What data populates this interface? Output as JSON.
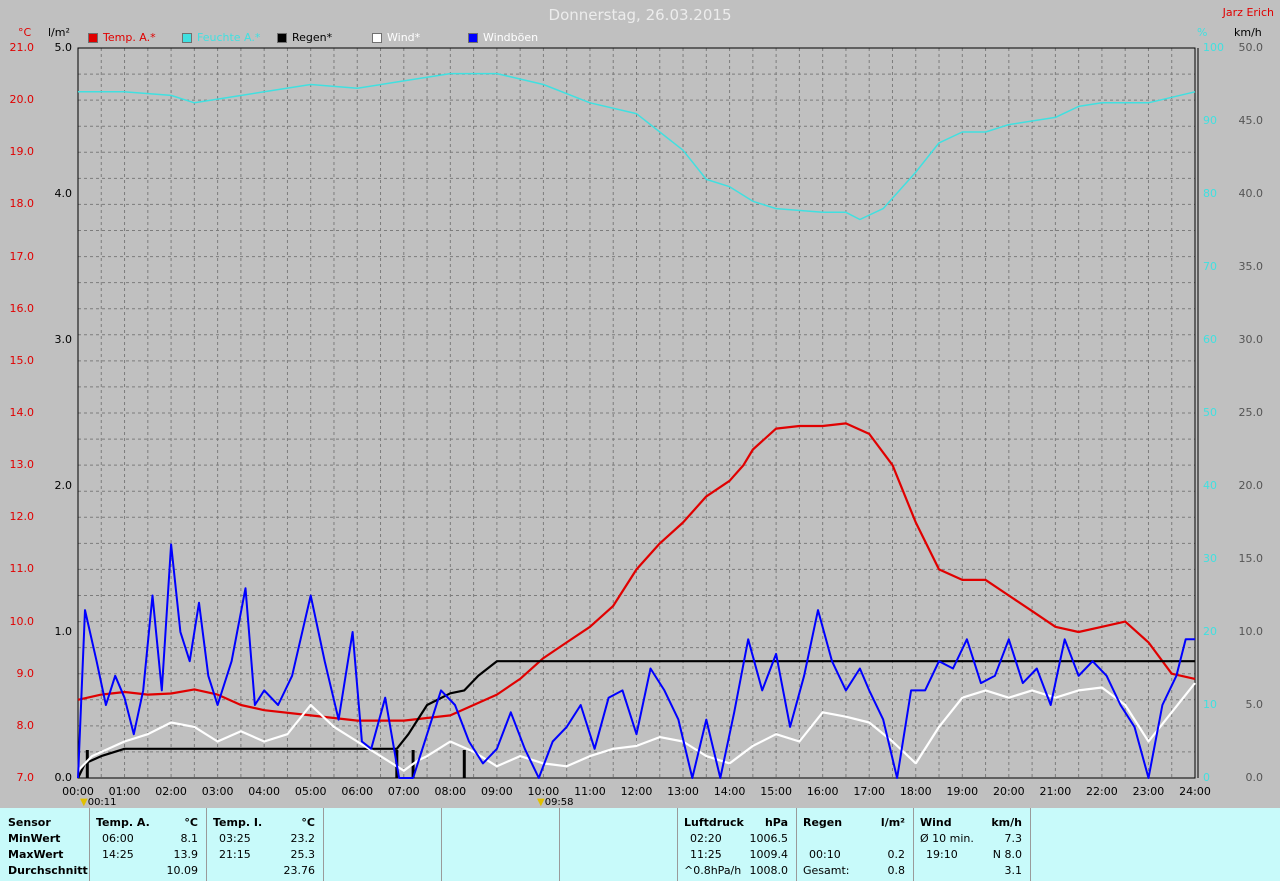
{
  "title": "Donnerstag, 26.03.2015",
  "author": "Jarz Erich",
  "axis_units": {
    "left_temp": "°C",
    "left_rain": "l/m²",
    "right_humidity": "%",
    "right_wind": "km/h"
  },
  "legend": [
    {
      "label": "Temp. A.*",
      "color": "#e00000"
    },
    {
      "label": "Feuchte A.*",
      "color": "#40e0e0"
    },
    {
      "label": "Regen*",
      "color": "#000000"
    },
    {
      "label": "Wind*",
      "color": "#ffffff"
    },
    {
      "label": "Windböen",
      "color": "#0000ff"
    }
  ],
  "markers": {
    "rain_start": "00:11",
    "wind_peak": "09:58"
  },
  "colors": {
    "background": "#c0c0c0",
    "grid": "#808080",
    "panel": "#c8fafa"
  },
  "chart_data": {
    "type": "line",
    "x": [
      "00:00",
      "01:00",
      "02:00",
      "03:00",
      "04:00",
      "05:00",
      "06:00",
      "07:00",
      "08:00",
      "09:00",
      "10:00",
      "11:00",
      "12:00",
      "13:00",
      "14:00",
      "15:00",
      "16:00",
      "17:00",
      "18:00",
      "19:00",
      "20:00",
      "21:00",
      "22:00",
      "23:00",
      "24:00"
    ],
    "xlim": [
      0,
      24
    ],
    "axes": {
      "temp": {
        "ylim": [
          7.0,
          21.0
        ],
        "ticks": [
          "21.0",
          "20.0",
          "19.0",
          "18.0",
          "17.0",
          "16.0",
          "15.0",
          "14.0",
          "13.0",
          "12.0",
          "11.0",
          "10.0",
          "9.0",
          "8.0",
          "7.0"
        ]
      },
      "rain": {
        "ylim": [
          0.0,
          5.0
        ],
        "ticks": [
          "5.0",
          "4.0",
          "3.0",
          "2.0",
          "1.0",
          "0.0"
        ]
      },
      "humidity": {
        "ylim": [
          0,
          100
        ],
        "ticks": [
          "100",
          "90",
          "80",
          "70",
          "60",
          "50",
          "40",
          "30",
          "20",
          "10",
          "0"
        ]
      },
      "wind": {
        "ylim": [
          0.0,
          50.0
        ],
        "ticks": [
          "50.0",
          "45.0",
          "40.0",
          "35.0",
          "30.0",
          "25.0",
          "20.0",
          "15.0",
          "10.0",
          "5.0",
          "0.0"
        ]
      }
    },
    "grid": true,
    "series": [
      {
        "name": "Temp. A.*",
        "axis": "temp",
        "color": "#e00000",
        "points": [
          [
            0,
            8.5
          ],
          [
            0.5,
            8.6
          ],
          [
            1,
            8.65
          ],
          [
            1.5,
            8.6
          ],
          [
            2,
            8.62
          ],
          [
            2.5,
            8.7
          ],
          [
            3,
            8.6
          ],
          [
            3.5,
            8.4
          ],
          [
            4,
            8.3
          ],
          [
            5,
            8.2
          ],
          [
            6,
            8.1
          ],
          [
            7,
            8.1
          ],
          [
            8,
            8.2
          ],
          [
            9,
            8.6
          ],
          [
            9.5,
            8.9
          ],
          [
            10,
            9.3
          ],
          [
            10.5,
            9.6
          ],
          [
            11,
            9.9
          ],
          [
            11.5,
            10.3
          ],
          [
            12,
            11.0
          ],
          [
            12.5,
            11.5
          ],
          [
            13,
            11.9
          ],
          [
            13.5,
            12.4
          ],
          [
            14,
            12.7
          ],
          [
            14.3,
            13.0
          ],
          [
            14.5,
            13.3
          ],
          [
            15,
            13.7
          ],
          [
            15.5,
            13.75
          ],
          [
            16,
            13.75
          ],
          [
            16.5,
            13.8
          ],
          [
            17,
            13.6
          ],
          [
            17.5,
            13.0
          ],
          [
            18,
            11.9
          ],
          [
            18.5,
            11.0
          ],
          [
            19,
            10.8
          ],
          [
            19.5,
            10.8
          ],
          [
            20,
            10.5
          ],
          [
            20.5,
            10.2
          ],
          [
            21,
            9.9
          ],
          [
            21.5,
            9.8
          ],
          [
            22,
            9.9
          ],
          [
            22.5,
            10.0
          ],
          [
            23,
            9.6
          ],
          [
            23.5,
            9.0
          ],
          [
            24,
            8.9
          ]
        ]
      },
      {
        "name": "Feuchte A.*",
        "axis": "humidity",
        "color": "#40e0e0",
        "points": [
          [
            0,
            94
          ],
          [
            1,
            94
          ],
          [
            2,
            93.5
          ],
          [
            2.5,
            92.5
          ],
          [
            3,
            93
          ],
          [
            4,
            94
          ],
          [
            5,
            95
          ],
          [
            6,
            94.5
          ],
          [
            7,
            95.5
          ],
          [
            8,
            96.5
          ],
          [
            9,
            96.5
          ],
          [
            10,
            95
          ],
          [
            11,
            92.5
          ],
          [
            12,
            91
          ],
          [
            13,
            86
          ],
          [
            13.5,
            82
          ],
          [
            14,
            81
          ],
          [
            14.5,
            79
          ],
          [
            15,
            78
          ],
          [
            16,
            77.5
          ],
          [
            16.5,
            77.5
          ],
          [
            16.8,
            76.5
          ],
          [
            17.3,
            78
          ],
          [
            18,
            83
          ],
          [
            18.5,
            87
          ],
          [
            19,
            88.5
          ],
          [
            19.5,
            88.5
          ],
          [
            20,
            89.5
          ],
          [
            21,
            90.5
          ],
          [
            21.5,
            92
          ],
          [
            22,
            92.5
          ],
          [
            23,
            92.5
          ],
          [
            24,
            94
          ]
        ]
      },
      {
        "name": "Regen*",
        "axis": "rain",
        "color": "#000000",
        "points": [
          [
            0,
            0.0
          ],
          [
            0.15,
            0.1
          ],
          [
            0.5,
            0.15
          ],
          [
            1,
            0.2
          ],
          [
            2,
            0.2
          ],
          [
            3,
            0.2
          ],
          [
            4,
            0.2
          ],
          [
            5,
            0.2
          ],
          [
            6,
            0.2
          ],
          [
            6.85,
            0.2
          ],
          [
            7.1,
            0.3
          ],
          [
            7.5,
            0.5
          ],
          [
            8,
            0.58
          ],
          [
            8.3,
            0.6
          ],
          [
            8.6,
            0.7
          ],
          [
            9,
            0.8
          ],
          [
            9.5,
            0.8
          ],
          [
            10,
            0.8
          ],
          [
            24,
            0.8
          ]
        ]
      },
      {
        "name": "Wind*",
        "axis": "wind",
        "color": "#ffffff",
        "points": [
          [
            0,
            0.5
          ],
          [
            0.3,
            1.5
          ],
          [
            1,
            2.5
          ],
          [
            1.5,
            3
          ],
          [
            2,
            3.8
          ],
          [
            2.5,
            3.5
          ],
          [
            3,
            2.5
          ],
          [
            3.5,
            3.2
          ],
          [
            4,
            2.5
          ],
          [
            4.5,
            3
          ],
          [
            5,
            5
          ],
          [
            5.5,
            3.5
          ],
          [
            6,
            2.5
          ],
          [
            6.5,
            1.5
          ],
          [
            7,
            0.5
          ],
          [
            7.3,
            1.2
          ],
          [
            7.5,
            1.5
          ],
          [
            8,
            2.5
          ],
          [
            8.5,
            1.8
          ],
          [
            9,
            0.8
          ],
          [
            9.5,
            1.5
          ],
          [
            10,
            1
          ],
          [
            10.5,
            0.8
          ],
          [
            11,
            1.5
          ],
          [
            11.5,
            2
          ],
          [
            12,
            2.2
          ],
          [
            12.5,
            2.8
          ],
          [
            13,
            2.5
          ],
          [
            13.5,
            1.5
          ],
          [
            14,
            1
          ],
          [
            14.5,
            2.2
          ],
          [
            15,
            3
          ],
          [
            15.5,
            2.5
          ],
          [
            16,
            4.5
          ],
          [
            16.5,
            4.2
          ],
          [
            17,
            3.8
          ],
          [
            17.5,
            2.5
          ],
          [
            18,
            1
          ],
          [
            18.5,
            3.5
          ],
          [
            19,
            5.5
          ],
          [
            19.5,
            6
          ],
          [
            20,
            5.5
          ],
          [
            20.5,
            6
          ],
          [
            21,
            5.5
          ],
          [
            21.5,
            6
          ],
          [
            22,
            6.2
          ],
          [
            22.5,
            5
          ],
          [
            23,
            2.5
          ],
          [
            23.5,
            4.5
          ],
          [
            24,
            6.5
          ]
        ]
      },
      {
        "name": "Windböen",
        "axis": "wind",
        "color": "#0000ff",
        "points": [
          [
            0,
            0
          ],
          [
            0.15,
            11.5
          ],
          [
            0.4,
            8
          ],
          [
            0.6,
            5
          ],
          [
            0.8,
            7
          ],
          [
            1,
            5.5
          ],
          [
            1.2,
            3
          ],
          [
            1.4,
            6
          ],
          [
            1.6,
            12.5
          ],
          [
            1.8,
            6
          ],
          [
            2,
            16
          ],
          [
            2.2,
            10
          ],
          [
            2.4,
            8
          ],
          [
            2.6,
            12
          ],
          [
            2.8,
            7
          ],
          [
            3,
            5
          ],
          [
            3.3,
            8
          ],
          [
            3.6,
            13
          ],
          [
            3.8,
            5
          ],
          [
            4,
            6
          ],
          [
            4.3,
            5
          ],
          [
            4.6,
            7
          ],
          [
            5,
            12.5
          ],
          [
            5.3,
            8
          ],
          [
            5.6,
            4
          ],
          [
            5.9,
            10
          ],
          [
            6.1,
            2.5
          ],
          [
            6.3,
            2
          ],
          [
            6.6,
            5.5
          ],
          [
            6.9,
            0
          ],
          [
            7.2,
            0
          ],
          [
            7.5,
            3
          ],
          [
            7.8,
            6
          ],
          [
            8.1,
            5
          ],
          [
            8.4,
            2.5
          ],
          [
            8.7,
            1
          ],
          [
            9,
            2
          ],
          [
            9.3,
            4.5
          ],
          [
            9.6,
            2
          ],
          [
            9.9,
            0
          ],
          [
            10.2,
            2.5
          ],
          [
            10.5,
            3.5
          ],
          [
            10.8,
            5
          ],
          [
            11.1,
            2
          ],
          [
            11.4,
            5.5
          ],
          [
            11.7,
            6
          ],
          [
            12,
            3
          ],
          [
            12.3,
            7.5
          ],
          [
            12.6,
            6
          ],
          [
            12.9,
            4
          ],
          [
            13.2,
            0
          ],
          [
            13.5,
            4
          ],
          [
            13.8,
            0
          ],
          [
            14.1,
            4.5
          ],
          [
            14.4,
            9.5
          ],
          [
            14.7,
            6
          ],
          [
            15,
            8.5
          ],
          [
            15.3,
            3.5
          ],
          [
            15.6,
            7
          ],
          [
            15.9,
            11.5
          ],
          [
            16.2,
            8
          ],
          [
            16.5,
            6
          ],
          [
            16.8,
            7.5
          ],
          [
            17,
            6
          ],
          [
            17.3,
            4
          ],
          [
            17.6,
            0
          ],
          [
            17.9,
            6
          ],
          [
            18.2,
            6
          ],
          [
            18.5,
            8
          ],
          [
            18.8,
            7.5
          ],
          [
            19.1,
            9.5
          ],
          [
            19.4,
            6.5
          ],
          [
            19.7,
            7
          ],
          [
            20,
            9.5
          ],
          [
            20.3,
            6.5
          ],
          [
            20.6,
            7.5
          ],
          [
            20.9,
            5
          ],
          [
            21.2,
            9.5
          ],
          [
            21.5,
            7
          ],
          [
            21.8,
            8
          ],
          [
            22.1,
            7
          ],
          [
            22.4,
            5
          ],
          [
            22.7,
            3.5
          ],
          [
            23,
            0
          ],
          [
            23.3,
            5
          ],
          [
            23.6,
            7
          ],
          [
            23.8,
            9.5
          ],
          [
            24,
            9.5
          ]
        ]
      }
    ]
  },
  "summary": {
    "row_labels": [
      "Sensor",
      "MinWert",
      "MaxWert",
      "Durchschnitt"
    ],
    "temp_a": {
      "header": "Temp. A.",
      "unit": "°C",
      "min_time": "06:00",
      "min_val": "8.1",
      "max_time": "14:25",
      "max_val": "13.9",
      "avg_val": "10.09"
    },
    "temp_i": {
      "header": "Temp. I.",
      "unit": "°C",
      "min_time": "03:25",
      "min_val": "23.2",
      "max_time": "21:15",
      "max_val": "25.3",
      "avg_val": "23.76"
    },
    "pressure": {
      "header": "Luftdruck",
      "unit": "hPa",
      "min_time": "02:20",
      "min_val": "1006.5",
      "max_time": "11:25",
      "max_val": "1009.4",
      "avg_label": "^0.8hPa/h",
      "avg_val": "1008.0"
    },
    "rain": {
      "header": "Regen",
      "unit": "l/m²",
      "max_time": "00:10",
      "max_val": "0.2",
      "total_label": "Gesamt:",
      "total_val": "0.8"
    },
    "wind": {
      "header": "Wind",
      "unit": "km/h",
      "min_label": "Ø 10 min.",
      "min_val": "7.3",
      "max_time": "19:10",
      "max_val": "N 8.0",
      "avg_val": "3.1"
    }
  }
}
